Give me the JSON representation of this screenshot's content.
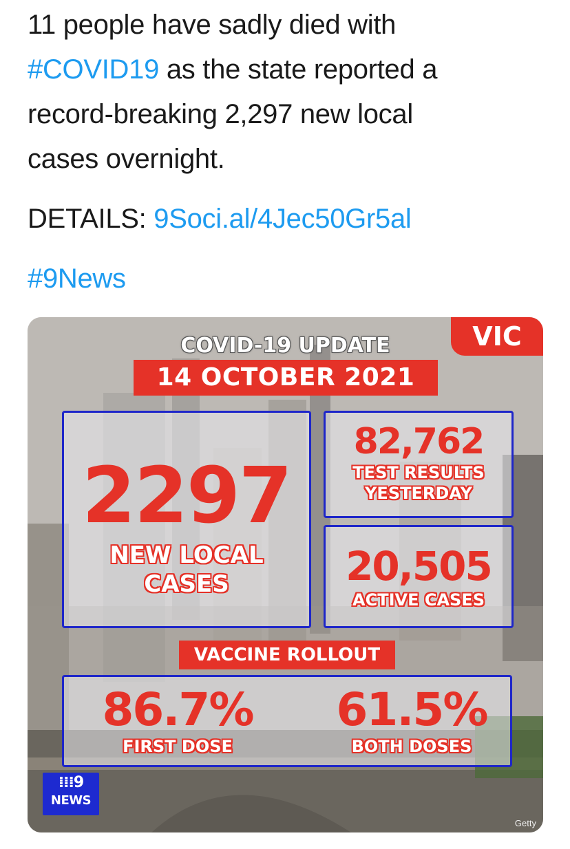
{
  "tweet": {
    "line1": "11 people have sadly died with",
    "hashtag_covid": "#COVID19",
    "line2_rest": " as the state reported a",
    "line3": "record-breaking 2,297 new local",
    "line4": "cases overnight.",
    "details_label": "DETAILS: ",
    "details_link": "9Soci.al/4Jec50Gr5al",
    "hashtag_news": "#9News"
  },
  "infographic": {
    "title": "COVID-19 UPDATE",
    "date": "14 OCTOBER 2021",
    "region": "VIC",
    "new_cases_value": "2297",
    "new_cases_label_1": "NEW LOCAL",
    "new_cases_label_2": "CASES",
    "tests_value": "82,762",
    "tests_label_1": "TEST RESULTS",
    "tests_label_2": "YESTERDAY",
    "active_value": "20,505",
    "active_label": "ACTIVE CASES",
    "rollout_title": "VACCINE ROLLOUT",
    "first_dose_value": "86.7%",
    "first_dose_label": "FIRST DOSE",
    "both_doses_value": "61.5%",
    "both_doses_label": "BOTH DOSES",
    "logo_word": "NEWS",
    "logo_digit": "9",
    "credit": "Getty"
  },
  "colors": {
    "link": "#1d9bf0",
    "accent_red": "#e53228",
    "panel_blue": "#1e26c9"
  }
}
